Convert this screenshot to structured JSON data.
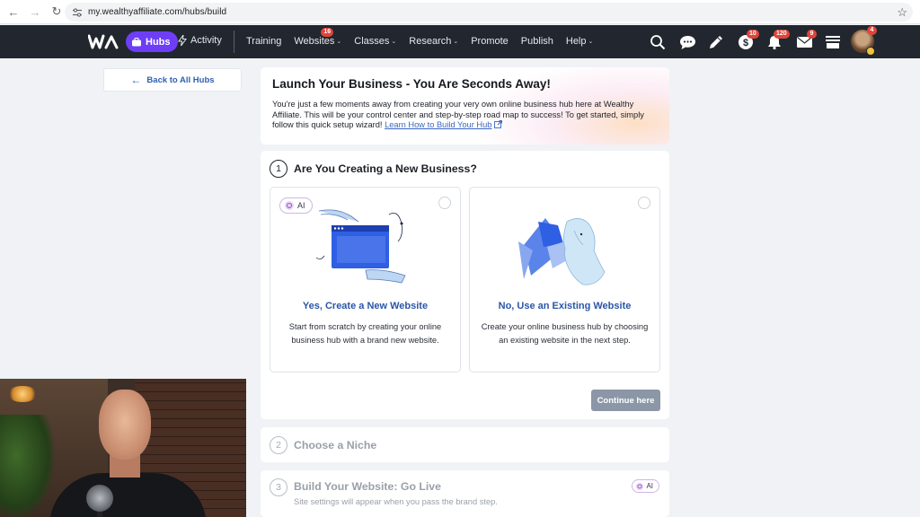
{
  "browser": {
    "url": "my.wealthyaffiliate.com/hubs/build"
  },
  "topnav": {
    "hubs_label": "Hubs",
    "activity_label": "Activity",
    "menu": [
      {
        "label": "Training",
        "caret": false,
        "badge": ""
      },
      {
        "label": "Websites",
        "caret": true,
        "badge": "16"
      },
      {
        "label": "Classes",
        "caret": true,
        "badge": ""
      },
      {
        "label": "Research",
        "caret": true,
        "badge": ""
      },
      {
        "label": "Promote",
        "caret": false,
        "badge": ""
      },
      {
        "label": "Publish",
        "caret": false,
        "badge": ""
      },
      {
        "label": "Help",
        "caret": true,
        "badge": ""
      }
    ],
    "icons": [
      {
        "name": "search-icon",
        "badge": ""
      },
      {
        "name": "chat-icon",
        "badge": ""
      },
      {
        "name": "pencil-icon",
        "badge": ""
      },
      {
        "name": "dollar-icon",
        "badge": "10"
      },
      {
        "name": "bell-icon",
        "badge": "120"
      },
      {
        "name": "mail-icon",
        "badge": "9"
      },
      {
        "name": "archive-icon",
        "badge": ""
      }
    ],
    "avatar_badge": "4"
  },
  "back_button": {
    "label": "Back to All Hubs"
  },
  "intro": {
    "title": "Launch Your Business - You Are Seconds Away!",
    "body": "You're just a few moments away from creating your very own online business hub here at Wealthy Affiliate. This will be your control center and step-by-step road map to success! To get started, simply follow this quick setup wizard!",
    "link_text": "Learn How to Build Your Hub"
  },
  "step1": {
    "number": "1",
    "title": "Are You Creating a New Business?",
    "options": [
      {
        "ai_label": "AI",
        "title": "Yes, Create a New Website",
        "desc": "Start from scratch by creating your online business hub with a brand new website."
      },
      {
        "title": "No, Use an Existing Website",
        "desc": "Create your online business hub by choosing an existing website in the next step."
      }
    ],
    "continue_label": "Continue here"
  },
  "step2": {
    "number": "2",
    "title": "Choose a Niche"
  },
  "step3": {
    "number": "3",
    "title": "Build Your Website: Go Live",
    "subtitle": "Site settings will appear when you pass the brand step.",
    "ai_label": "AI"
  },
  "colors": {
    "nav_bg": "#22272f",
    "accent_purple": "#6d3ef5",
    "link_blue": "#2a56a6",
    "badge_red": "#e0443a",
    "button_gray": "#8b97a6"
  }
}
